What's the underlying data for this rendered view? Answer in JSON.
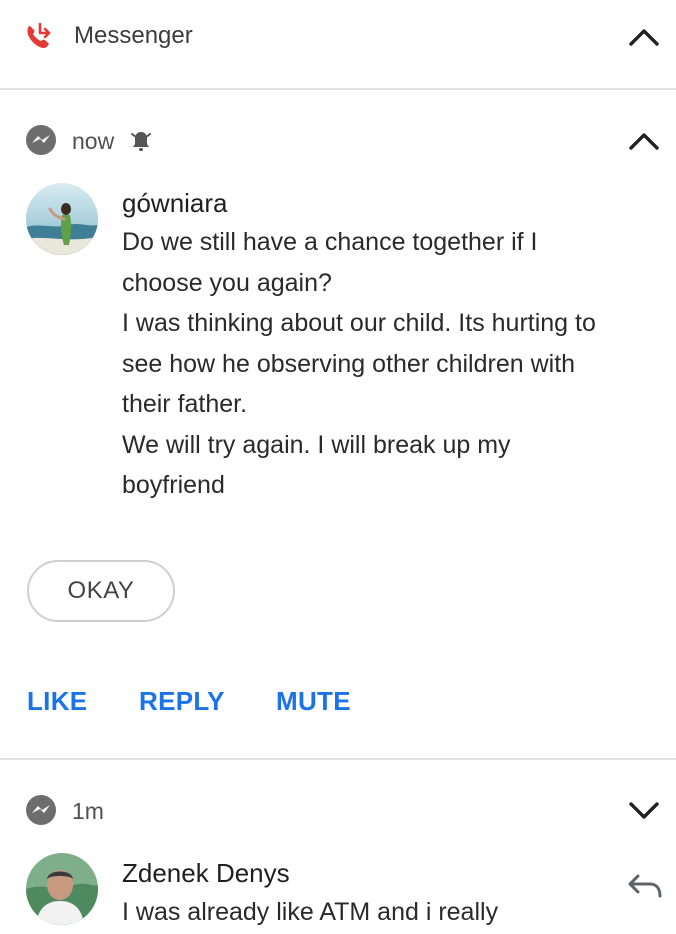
{
  "app": {
    "title": "Messenger",
    "icon": "missed-call-icon",
    "accent_color": "#e53935"
  },
  "notifications": [
    {
      "time": "now",
      "silenced_icon": "bell-off-icon",
      "expanded": true,
      "sender": "gówniara",
      "message_lines": [
        "Do we still have a chance together if I",
        "choose you again?",
        "I was thinking about our child. Its hurting to",
        "see how he observing other children with",
        "their father.",
        "We will try again. I will break up my",
        "boyfriend"
      ],
      "quick_reply": "OKAY",
      "actions": [
        "LIKE",
        "REPLY",
        "MUTE"
      ],
      "action_color": "#1a73e8"
    },
    {
      "time": "1m",
      "expanded": false,
      "sender": "Zdenek Denys",
      "message_lines": [
        "I was already like ATM and i really"
      ]
    }
  ]
}
